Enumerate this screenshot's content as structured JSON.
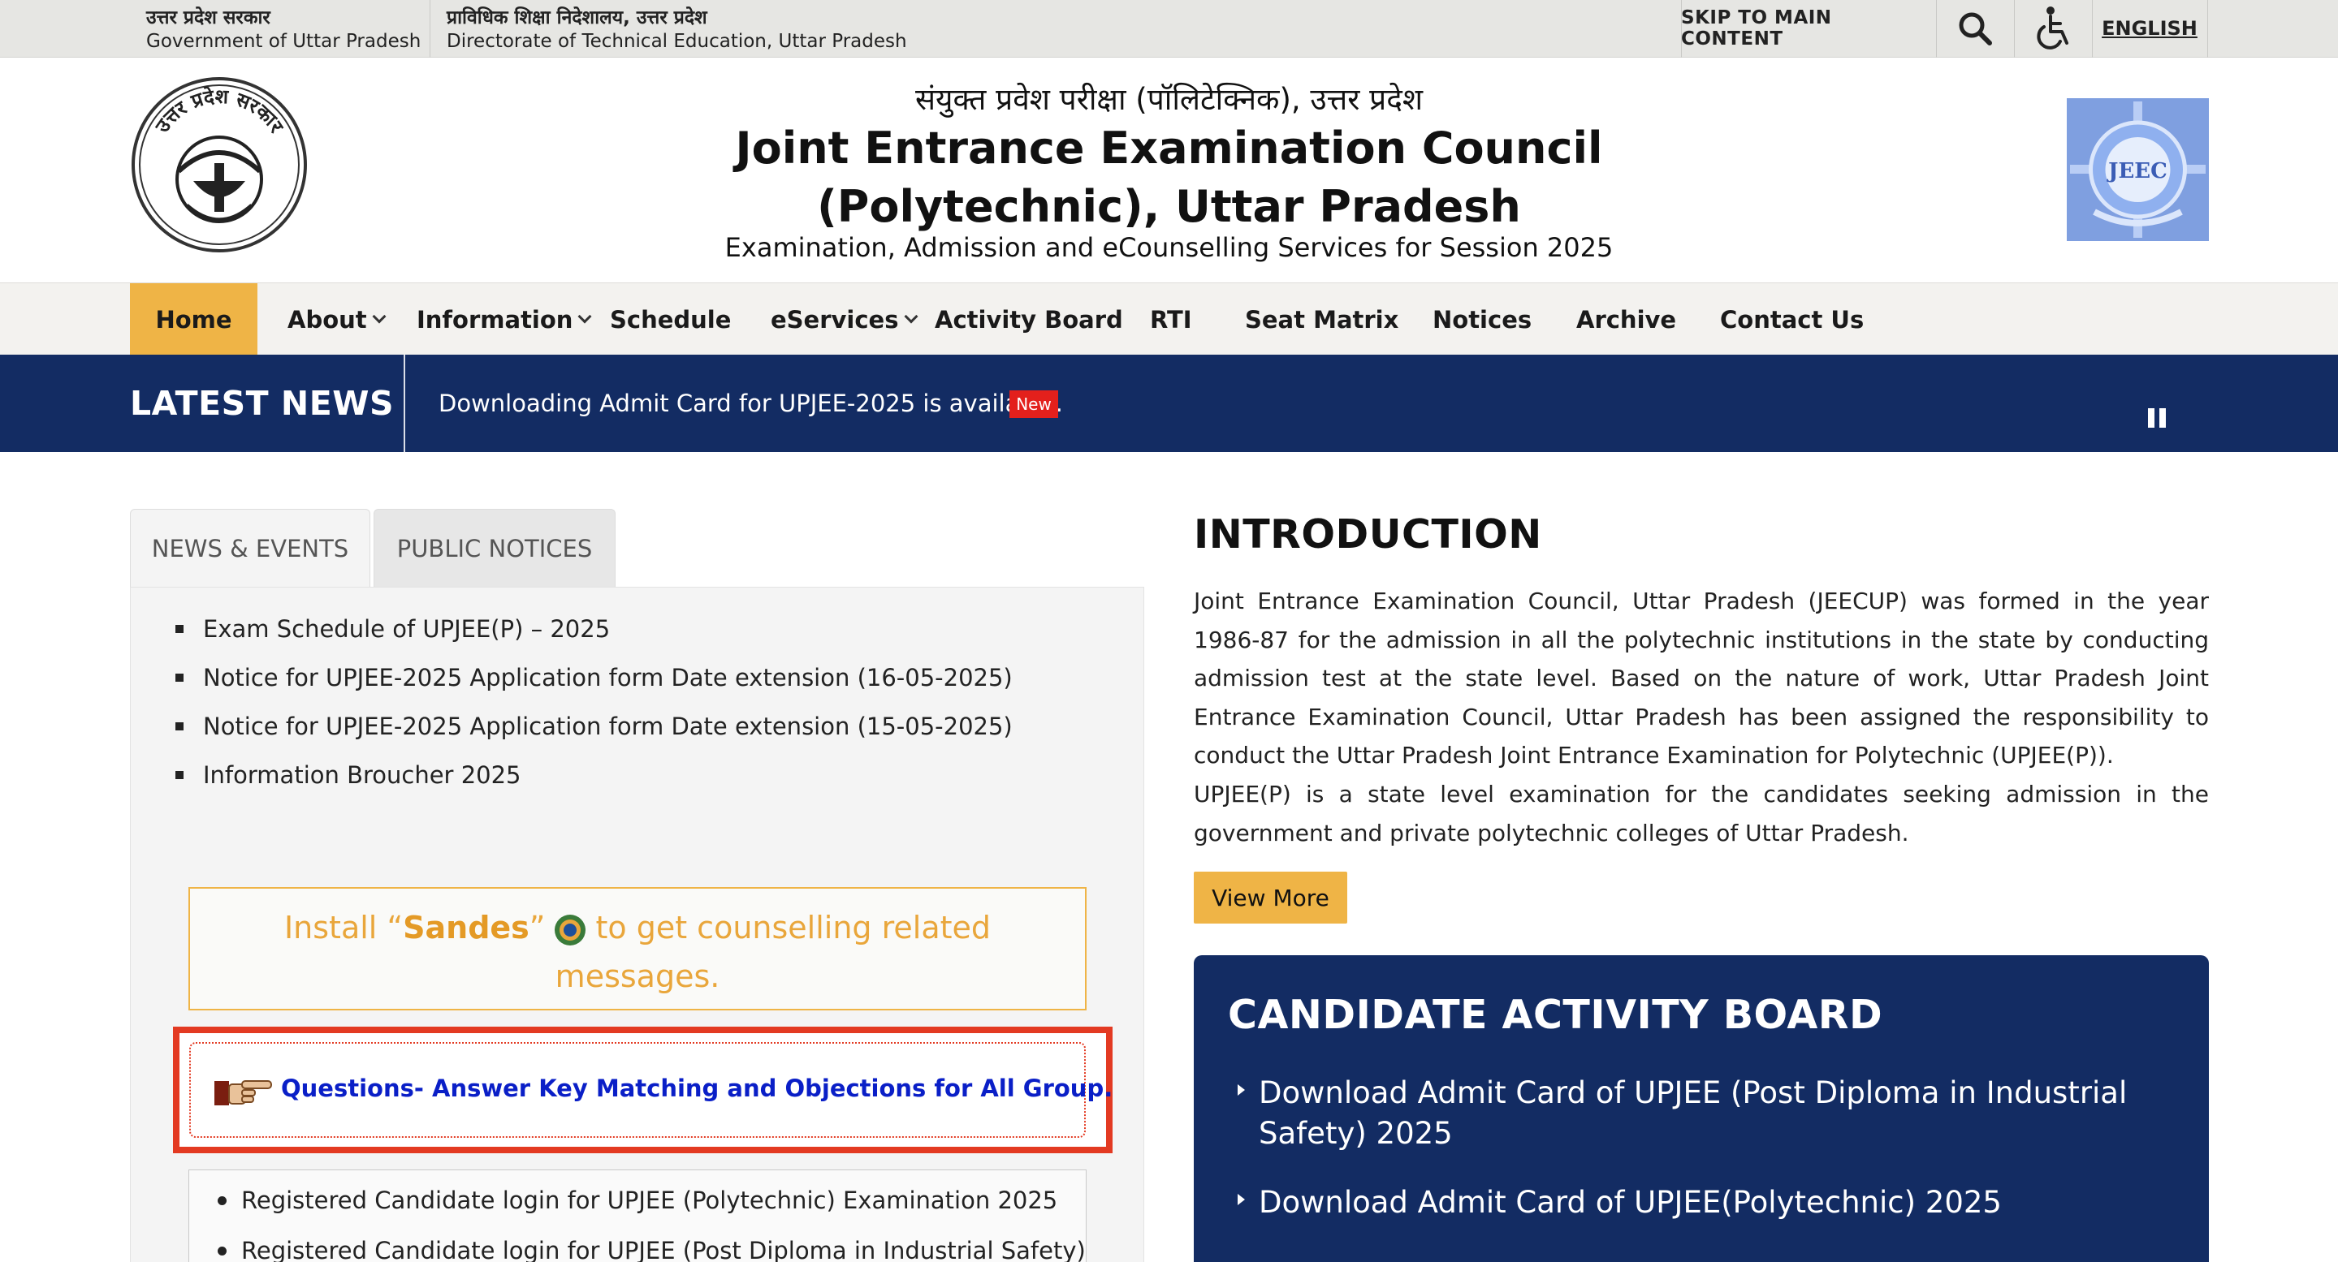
{
  "topbar": {
    "gov_up_hi": "उत्तर प्रदेश सरकार",
    "gov_up_en": "Government of Uttar Pradesh",
    "gov_dte_hi": "प्राविधिक शिक्षा निदेशालय, उत्तर प्रदेश",
    "gov_dte_en": "Directorate of Technical Education, Uttar Pradesh",
    "skip_label": "SKIP TO MAIN CONTENT",
    "search_icon": "search-icon",
    "accessibility_icon": "wheelchair-icon",
    "language_label": "ENGLISH"
  },
  "header": {
    "title_hi": "संयुक्त प्रवेश परीक्षा (पॉलिटेक्निक), उत्तर प्रदेश",
    "title_en_line1": "Joint Entrance Examination Council",
    "title_en_line2": "(Polytechnic), Uttar Pradesh",
    "subtitle": "Examination, Admission and eCounselling Services for Session 2025",
    "left_logo_text": "उत्तर प्रदेश सरकार",
    "right_logo_text": "JEEC"
  },
  "nav": {
    "items": [
      {
        "label": "Home",
        "active": true,
        "dropdown": false
      },
      {
        "label": "About",
        "active": false,
        "dropdown": true
      },
      {
        "label": "Information",
        "active": false,
        "dropdown": true
      },
      {
        "label": "Schedule",
        "active": false,
        "dropdown": false
      },
      {
        "label": "eServices",
        "active": false,
        "dropdown": true
      },
      {
        "label": "Activity Board",
        "active": false,
        "dropdown": false
      },
      {
        "label": "RTI",
        "active": false,
        "dropdown": false
      },
      {
        "label": "Seat Matrix",
        "active": false,
        "dropdown": false
      },
      {
        "label": "Notices",
        "active": false,
        "dropdown": false
      },
      {
        "label": "Archive",
        "active": false,
        "dropdown": false
      },
      {
        "label": "Contact Us",
        "active": false,
        "dropdown": false
      }
    ]
  },
  "latest_news": {
    "title": "LATEST NEWS",
    "text": "Downloading Admit Card for UPJEE-2025 is available.",
    "badge": "New",
    "pause_icon": "pause-icon"
  },
  "left_panel": {
    "tabs": [
      {
        "label": "NEWS & EVENTS",
        "active": true
      },
      {
        "label": "PUBLIC NOTICES",
        "active": false
      }
    ],
    "news_items": [
      "Exam Schedule of UPJEE(P) – 2025",
      "Notice for UPJEE-2025 Application form Date extension (16-05-2025)",
      "Notice for UPJEE-2025 Application form Date extension (15-05-2025)",
      "Information Broucher 2025"
    ],
    "sandes": {
      "before": "Install “",
      "app": "Sandes",
      "after_quote": "”",
      "line1_end": "to get counselling related",
      "line2": "messages."
    },
    "qa_link": "Questions- Answer Key Matching and Objections for All Group.",
    "login_items": [
      "Registered Candidate login for UPJEE (Polytechnic) Examination 2025",
      "Registered Candidate login for UPJEE (Post Diploma in Industrial Safety)"
    ]
  },
  "intro": {
    "title": "INTRODUCTION",
    "p1": "Joint Entrance Examination Council, Uttar Pradesh (JEECUP) was formed in the year 1986-87 for the admission in all the polytechnic institutions in the state by conducting admission test at the state level. Based on the nature of work, Uttar Pradesh Joint Entrance Examination Council, Uttar Pradesh has been assigned the responsibility to conduct the Uttar Pradesh Joint Entrance Examination for Polytechnic (UPJEE(P)).",
    "p2": "UPJEE(P) is a state level examination for the candidates seeking admission in the government and private polytechnic colleges of Uttar Pradesh.",
    "view_more": "View More"
  },
  "activity_board": {
    "title": "CANDIDATE ACTIVITY BOARD",
    "items": [
      "Download Admit Card of UPJEE (Post Diploma in Industrial Safety) 2025",
      "Download Admit Card of UPJEE(Polytechnic) 2025"
    ]
  },
  "colors": {
    "accent": "#efb446",
    "navy": "#132c63",
    "highlight_red": "#e33a22",
    "link_blue": "#0a1fc7",
    "badge_red": "#e3201c"
  }
}
